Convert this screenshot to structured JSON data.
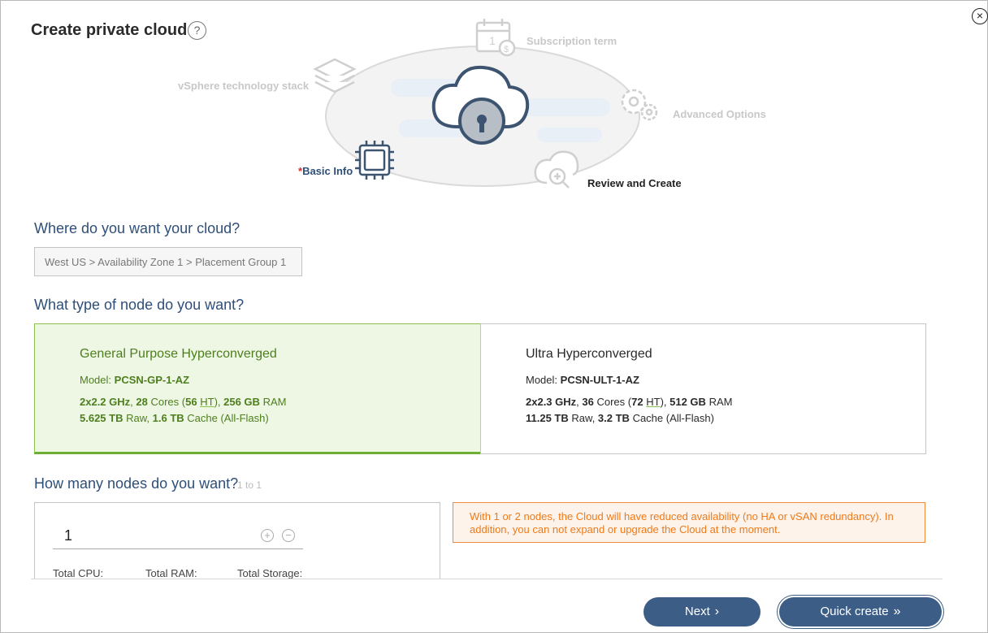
{
  "header": {
    "title": "Create private cloud",
    "help_icon": "question-circle-icon",
    "close_icon": "close-circle-icon"
  },
  "wizard": {
    "steps": [
      {
        "label": "Subscription term",
        "icon": "calendar-dollar-icon",
        "state": "inactive"
      },
      {
        "label": "vSphere technology stack",
        "icon": "layers-stack-icon",
        "state": "inactive"
      },
      {
        "label": "Advanced Options",
        "icon": "gears-icon",
        "state": "inactive"
      },
      {
        "required_mark": "*",
        "label": "Basic Info",
        "icon": "chip-icon",
        "state": "active"
      },
      {
        "label": "Review and Create",
        "icon": "cloud-zoom-icon",
        "state": "next"
      }
    ],
    "center_icon": "cloud-lock-icon"
  },
  "location": {
    "heading": "Where do you want your cloud?",
    "value": "West US > Availability Zone 1 > Placement Group 1"
  },
  "node_type": {
    "heading": "What type of node do you want?",
    "options": [
      {
        "title": "General Purpose Hyperconverged",
        "model_label": "Model:",
        "model": "PCSN-GP-1-AZ",
        "cpu": "2x2.2 GHz",
        "cores": "28",
        "cores_label": "Cores",
        "threads": "56",
        "ht_label": "HT",
        "ram": "256 GB",
        "ram_label": "RAM",
        "raw": "5.625 TB",
        "raw_label": "Raw",
        "cache": "1.6 TB",
        "cache_label": "Cache (All-Flash)",
        "selected": true
      },
      {
        "title": "Ultra Hyperconverged",
        "model_label": "Model:",
        "model": "PCSN-ULT-1-AZ",
        "cpu": "2x2.3 GHz",
        "cores": "36",
        "cores_label": "Cores",
        "threads": "72",
        "ht_label": "HT",
        "ram": "512 GB",
        "ram_label": "RAM",
        "raw": "11.25 TB",
        "raw_label": "Raw",
        "cache": "3.2 TB",
        "cache_label": "Cache (All-Flash)",
        "selected": false
      }
    ]
  },
  "nodes": {
    "heading": "How many nodes do you want?",
    "range_hint": "1 to 1",
    "value": "1",
    "increment_icon": "plus-circle-icon",
    "decrement_icon": "minus-circle-icon",
    "totals": {
      "cpu_label": "Total CPU:",
      "ram_label": "Total RAM:",
      "storage_label": "Total Storage:"
    }
  },
  "warning": {
    "text": "With 1 or 2 nodes, the Cloud will have reduced availability (no HA or vSAN redundancy). In addition, you can not expand or upgrade the Cloud at the moment."
  },
  "footer": {
    "next_label": "Next",
    "next_icon": "chevron-right-icon",
    "quick_label": "Quick create",
    "quick_icon": "double-chevron-right-icon"
  },
  "colors": {
    "primary": "#3c5e86",
    "heading": "#2e4f7a",
    "selected_bg": "#eef6e4",
    "selected_text": "#4d7f1e",
    "warning": "#ef7a1a",
    "required": "#d32f2f"
  }
}
